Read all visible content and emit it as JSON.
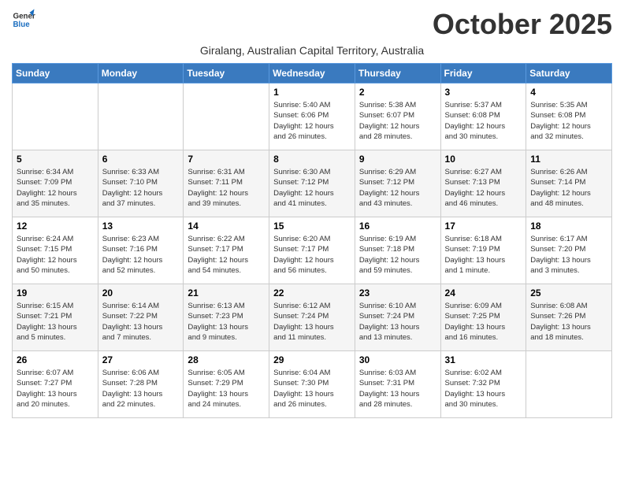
{
  "logo": {
    "text_general": "General",
    "text_blue": "Blue"
  },
  "title": "October 2025",
  "subtitle": "Giralang, Australian Capital Territory, Australia",
  "days_of_week": [
    "Sunday",
    "Monday",
    "Tuesday",
    "Wednesday",
    "Thursday",
    "Friday",
    "Saturday"
  ],
  "weeks": [
    [
      {
        "day": "",
        "info": ""
      },
      {
        "day": "",
        "info": ""
      },
      {
        "day": "",
        "info": ""
      },
      {
        "day": "1",
        "info": "Sunrise: 5:40 AM\nSunset: 6:06 PM\nDaylight: 12 hours\nand 26 minutes."
      },
      {
        "day": "2",
        "info": "Sunrise: 5:38 AM\nSunset: 6:07 PM\nDaylight: 12 hours\nand 28 minutes."
      },
      {
        "day": "3",
        "info": "Sunrise: 5:37 AM\nSunset: 6:08 PM\nDaylight: 12 hours\nand 30 minutes."
      },
      {
        "day": "4",
        "info": "Sunrise: 5:35 AM\nSunset: 6:08 PM\nDaylight: 12 hours\nand 32 minutes."
      }
    ],
    [
      {
        "day": "5",
        "info": "Sunrise: 6:34 AM\nSunset: 7:09 PM\nDaylight: 12 hours\nand 35 minutes."
      },
      {
        "day": "6",
        "info": "Sunrise: 6:33 AM\nSunset: 7:10 PM\nDaylight: 12 hours\nand 37 minutes."
      },
      {
        "day": "7",
        "info": "Sunrise: 6:31 AM\nSunset: 7:11 PM\nDaylight: 12 hours\nand 39 minutes."
      },
      {
        "day": "8",
        "info": "Sunrise: 6:30 AM\nSunset: 7:12 PM\nDaylight: 12 hours\nand 41 minutes."
      },
      {
        "day": "9",
        "info": "Sunrise: 6:29 AM\nSunset: 7:12 PM\nDaylight: 12 hours\nand 43 minutes."
      },
      {
        "day": "10",
        "info": "Sunrise: 6:27 AM\nSunset: 7:13 PM\nDaylight: 12 hours\nand 46 minutes."
      },
      {
        "day": "11",
        "info": "Sunrise: 6:26 AM\nSunset: 7:14 PM\nDaylight: 12 hours\nand 48 minutes."
      }
    ],
    [
      {
        "day": "12",
        "info": "Sunrise: 6:24 AM\nSunset: 7:15 PM\nDaylight: 12 hours\nand 50 minutes."
      },
      {
        "day": "13",
        "info": "Sunrise: 6:23 AM\nSunset: 7:16 PM\nDaylight: 12 hours\nand 52 minutes."
      },
      {
        "day": "14",
        "info": "Sunrise: 6:22 AM\nSunset: 7:17 PM\nDaylight: 12 hours\nand 54 minutes."
      },
      {
        "day": "15",
        "info": "Sunrise: 6:20 AM\nSunset: 7:17 PM\nDaylight: 12 hours\nand 56 minutes."
      },
      {
        "day": "16",
        "info": "Sunrise: 6:19 AM\nSunset: 7:18 PM\nDaylight: 12 hours\nand 59 minutes."
      },
      {
        "day": "17",
        "info": "Sunrise: 6:18 AM\nSunset: 7:19 PM\nDaylight: 13 hours\nand 1 minute."
      },
      {
        "day": "18",
        "info": "Sunrise: 6:17 AM\nSunset: 7:20 PM\nDaylight: 13 hours\nand 3 minutes."
      }
    ],
    [
      {
        "day": "19",
        "info": "Sunrise: 6:15 AM\nSunset: 7:21 PM\nDaylight: 13 hours\nand 5 minutes."
      },
      {
        "day": "20",
        "info": "Sunrise: 6:14 AM\nSunset: 7:22 PM\nDaylight: 13 hours\nand 7 minutes."
      },
      {
        "day": "21",
        "info": "Sunrise: 6:13 AM\nSunset: 7:23 PM\nDaylight: 13 hours\nand 9 minutes."
      },
      {
        "day": "22",
        "info": "Sunrise: 6:12 AM\nSunset: 7:24 PM\nDaylight: 13 hours\nand 11 minutes."
      },
      {
        "day": "23",
        "info": "Sunrise: 6:10 AM\nSunset: 7:24 PM\nDaylight: 13 hours\nand 13 minutes."
      },
      {
        "day": "24",
        "info": "Sunrise: 6:09 AM\nSunset: 7:25 PM\nDaylight: 13 hours\nand 16 minutes."
      },
      {
        "day": "25",
        "info": "Sunrise: 6:08 AM\nSunset: 7:26 PM\nDaylight: 13 hours\nand 18 minutes."
      }
    ],
    [
      {
        "day": "26",
        "info": "Sunrise: 6:07 AM\nSunset: 7:27 PM\nDaylight: 13 hours\nand 20 minutes."
      },
      {
        "day": "27",
        "info": "Sunrise: 6:06 AM\nSunset: 7:28 PM\nDaylight: 13 hours\nand 22 minutes."
      },
      {
        "day": "28",
        "info": "Sunrise: 6:05 AM\nSunset: 7:29 PM\nDaylight: 13 hours\nand 24 minutes."
      },
      {
        "day": "29",
        "info": "Sunrise: 6:04 AM\nSunset: 7:30 PM\nDaylight: 13 hours\nand 26 minutes."
      },
      {
        "day": "30",
        "info": "Sunrise: 6:03 AM\nSunset: 7:31 PM\nDaylight: 13 hours\nand 28 minutes."
      },
      {
        "day": "31",
        "info": "Sunrise: 6:02 AM\nSunset: 7:32 PM\nDaylight: 13 hours\nand 30 minutes."
      },
      {
        "day": "",
        "info": ""
      }
    ]
  ],
  "alt_rows": [
    1,
    3
  ]
}
